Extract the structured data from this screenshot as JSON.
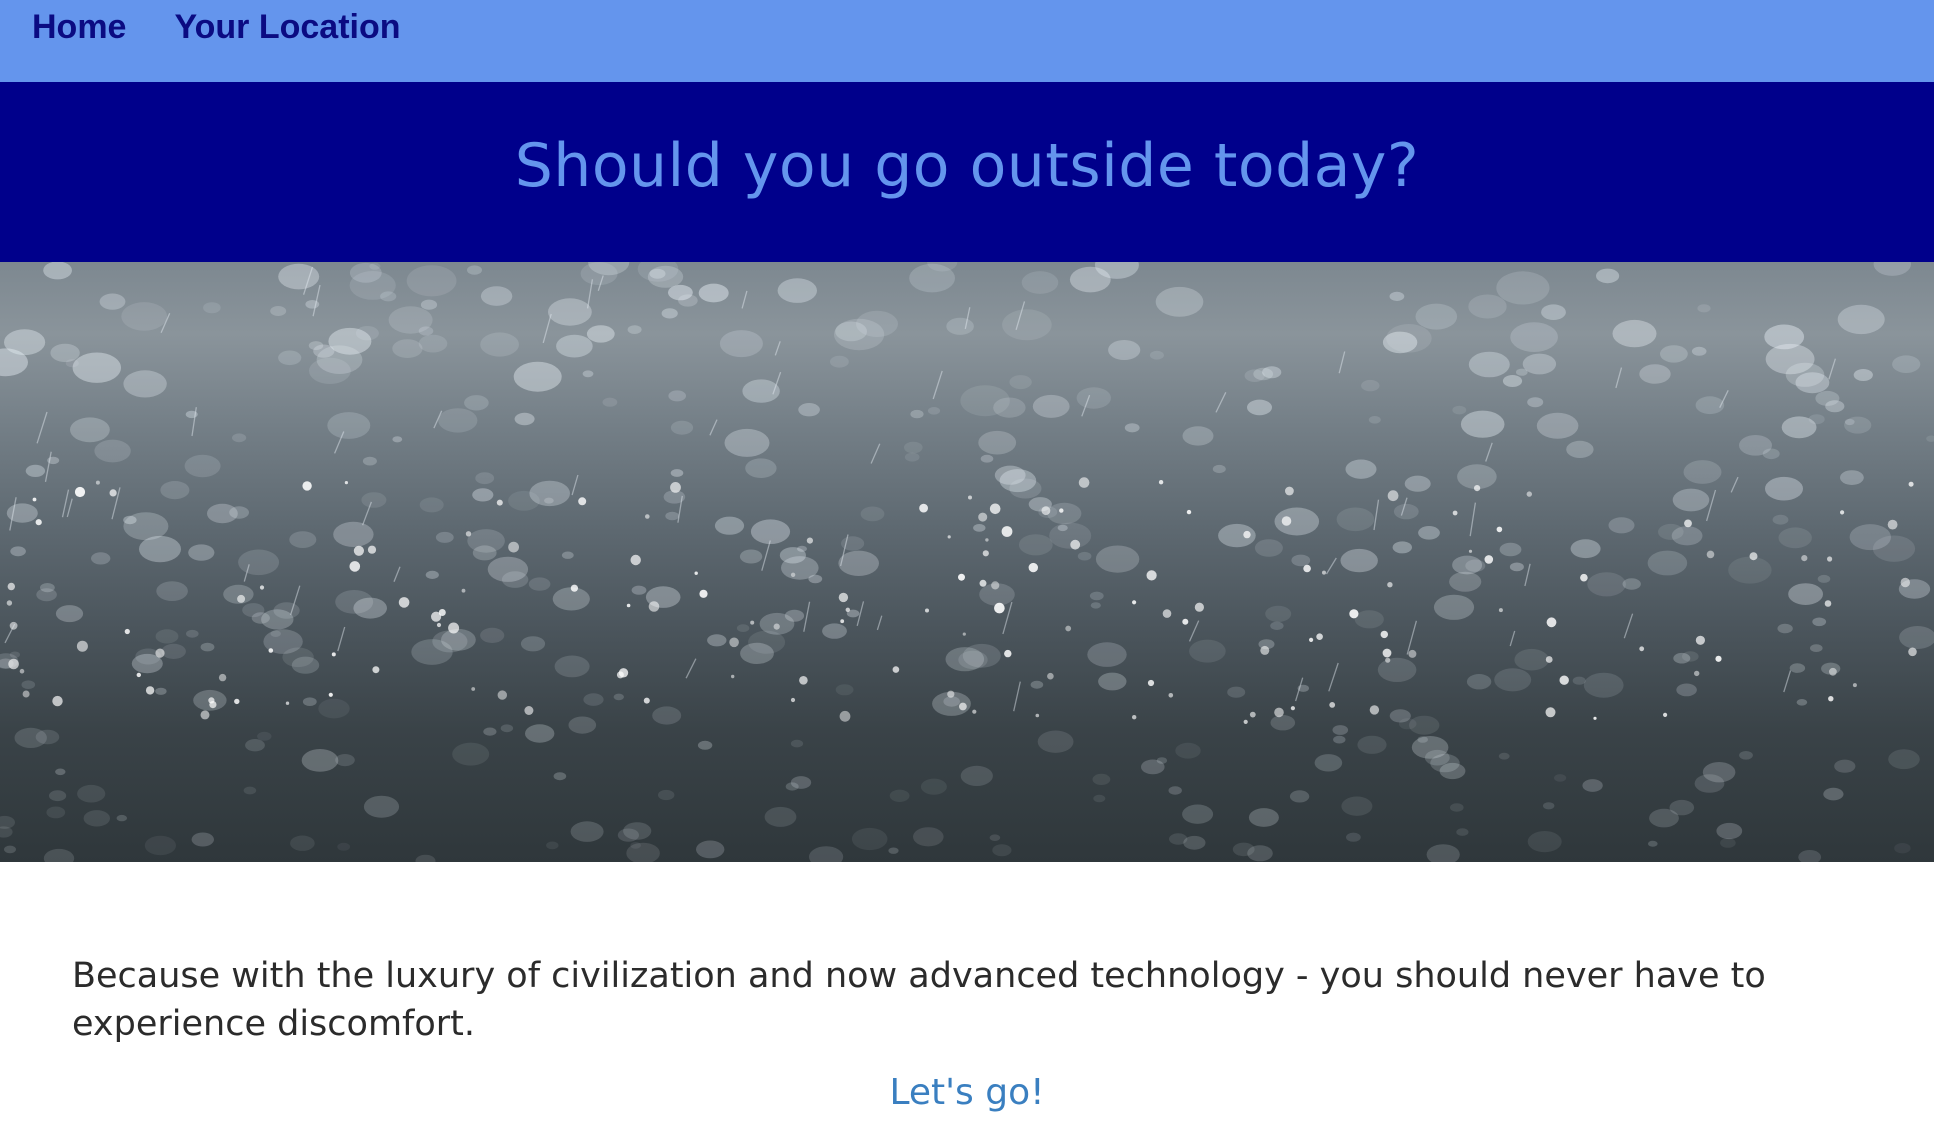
{
  "nav": {
    "items": [
      {
        "label": "Home"
      },
      {
        "label": "Your Location"
      }
    ]
  },
  "hero": {
    "title": "Should you go outside today?",
    "image_subject": "rain-splashes-on-water"
  },
  "main": {
    "paragraph": "Because with the luxury of civilization and now advanced technology - you should never have to experience discomfort.",
    "cta_label": "Let's go!"
  },
  "colors": {
    "nav_bg": "#6495ed",
    "nav_text": "#0b0b82",
    "hero_bg": "#00008b",
    "hero_text": "#6495ed",
    "body_text": "#2b2b2b",
    "link": "#3a7fc0"
  }
}
